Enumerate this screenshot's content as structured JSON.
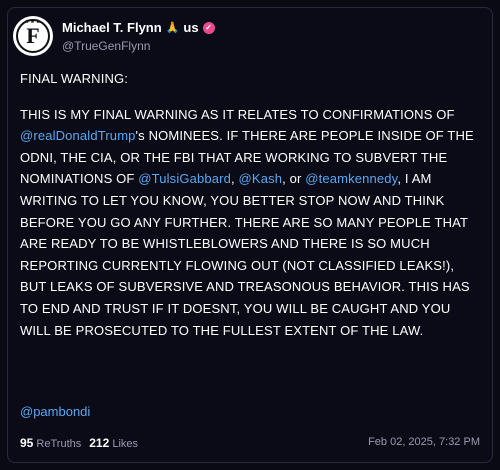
{
  "author": {
    "display_name": "Michael T. Flynn",
    "suffix": "us",
    "handle": "@TrueGenFlynn",
    "avatar_letter": "F",
    "pray_icon": "praying-hands-icon",
    "verified_color": "#e94b8a"
  },
  "post": {
    "heading": "FINAL WARNING:",
    "body_1": "THIS IS MY FINAL WARNING AS IT RELATES TO CONFIRMATIONS OF ",
    "mention_1": "@realDonaldTrump",
    "body_2": "'s NOMINEES. IF THERE ARE PEOPLE INSIDE OF THE ODNI, THE CIA, OR THE FBI THAT ARE WORKING TO SUBVERT THE NOMINATIONS OF ",
    "mention_2": "@TulsiGabbard",
    "sep_1": ", ",
    "mention_3": "@Kash",
    "sep_2": ", or ",
    "mention_4": "@teamkennedy",
    "body_3": ", I AM WRITING TO LET YOU KNOW, YOU BETTER STOP NOW AND THINK BEFORE YOU GO ANY FURTHER. THERE ARE SO MANY PEOPLE THAT ARE READY TO BE WHISTLEBLOWERS AND THERE IS SO MUCH REPORTING CURRENTLY FLOWING OUT (NOT CLASSIFIED LEAKS!), BUT LEAKS OF SUBVERSIVE AND TREASONOUS BEHAVIOR. THIS HAS TO END AND TRUST IF IT DOESNT, YOU WILL BE CAUGHT AND YOU WILL BE PROSECUTED TO THE FULLEST EXTENT OF THE LAW.",
    "mention_5": "@pambondi"
  },
  "stats": {
    "retruths_count": "95",
    "retruths_label": "ReTruths",
    "likes_count": "212",
    "likes_label": "Likes",
    "timestamp": "Feb 02, 2025, 7:32 PM"
  },
  "colors": {
    "background": "#0b0b18",
    "mention": "#5aa8f0",
    "muted": "#9a9ab0"
  }
}
